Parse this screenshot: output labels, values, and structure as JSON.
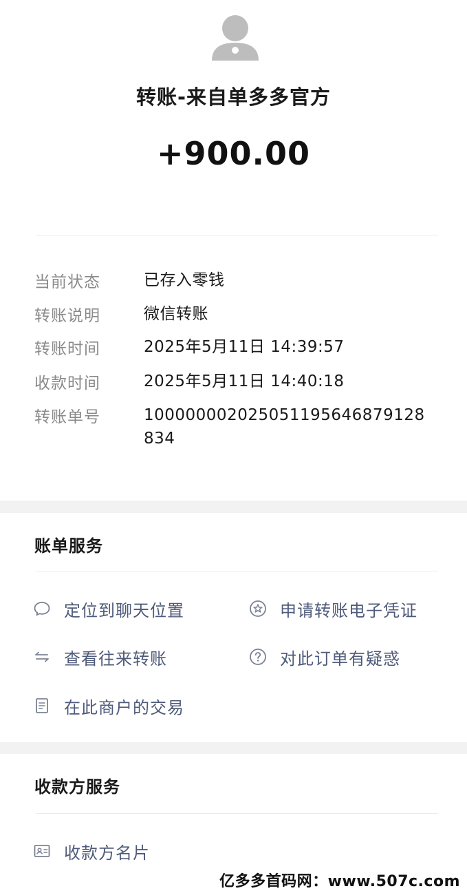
{
  "header": {
    "title": "转账-来自单多多官方",
    "amount": "+900.00"
  },
  "details": [
    {
      "label": "当前状态",
      "value": "已存入零钱"
    },
    {
      "label": "转账说明",
      "value": "微信转账"
    },
    {
      "label": "转账时间",
      "value": "2025年5月11日 14:39:57"
    },
    {
      "label": "收款时间",
      "value": "2025年5月11日 14:40:18"
    },
    {
      "label": "转账单号",
      "value": "100000002025051195646879128834"
    }
  ],
  "bill_services": {
    "title": "账单服务",
    "items": [
      {
        "label": "定位到聊天位置",
        "icon": "chat-bubble-icon"
      },
      {
        "label": "申请转账电子凭证",
        "icon": "badge-icon"
      },
      {
        "label": "查看往来转账",
        "icon": "transfer-arrows-icon"
      },
      {
        "label": "对此订单有疑惑",
        "icon": "question-icon"
      },
      {
        "label": "在此商户的交易",
        "icon": "receipt-icon"
      }
    ]
  },
  "payee_services": {
    "title": "收款方服务",
    "items": [
      {
        "label": "收款方名片",
        "icon": "contact-card-icon"
      }
    ]
  },
  "watermark": "亿多多首码网：www.507c.com",
  "colors": {
    "link_text": "#4f5b7a",
    "label_text": "#8a8a8a",
    "icon": "#7b8294",
    "page_bg": "#f2f2f2"
  }
}
